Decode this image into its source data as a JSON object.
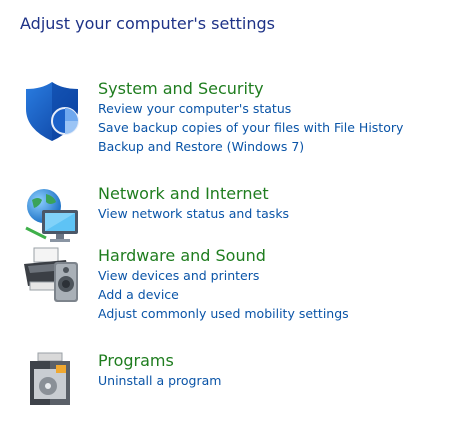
{
  "page_title": "Adjust your computer's settings",
  "categories": [
    {
      "title": "System and Security",
      "icon": "shield-icon",
      "links": [
        "Review your computer's status",
        "Save backup copies of your files with File History",
        "Backup and Restore (Windows 7)"
      ]
    },
    {
      "title": "Network and Internet",
      "icon": "network-globe-icon",
      "links": [
        "View network status and tasks"
      ]
    },
    {
      "title": "Hardware and Sound",
      "icon": "printer-speaker-icon",
      "links": [
        "View devices and printers",
        "Add a device",
        "Adjust commonly used mobility settings"
      ]
    },
    {
      "title": "Programs",
      "icon": "programs-box-icon",
      "links": [
        "Uninstall a program"
      ]
    }
  ],
  "colors": {
    "title": "#1e3287",
    "category_title": "#1f7d1f",
    "link": "#0a54a7"
  }
}
